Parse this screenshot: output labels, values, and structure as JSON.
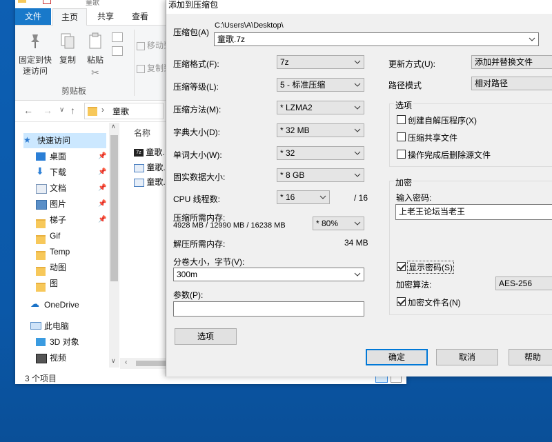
{
  "explorer": {
    "title": "童歌",
    "tabs": {
      "file": "文件",
      "home": "主页",
      "share": "共享",
      "view": "查看"
    },
    "ribbon": {
      "pin_label_1": "固定到快",
      "pin_label_2": "速访问",
      "copy_label": "复制",
      "paste_label": "粘贴",
      "move_to_label": "移动到",
      "copy_to_label": "复制到",
      "clipboard_group": "剪贴板"
    },
    "address": {
      "crumb": "童歌"
    },
    "nav": {
      "quick_access": "快速访问",
      "items": [
        "桌面",
        "下载",
        "文档",
        "图片",
        "梯子",
        "Gif",
        "Temp",
        "动图",
        "图"
      ],
      "onedrive": "OneDrive",
      "this_pc": "此电脑",
      "pc_items": [
        "3D 对象",
        "视频"
      ]
    },
    "filelist": {
      "header_name": "名称",
      "files": [
        "童歌.",
        "童歌.",
        "童歌."
      ]
    },
    "status": "3 个项目"
  },
  "dialog": {
    "title": "添加到压缩包",
    "archive_label": "压缩包(A)",
    "archive_path": "C:\\Users\\A\\Desktop\\",
    "archive_name": "童歌.7z",
    "format_label": "压缩格式(F):",
    "format_value": "7z",
    "level_label": "压缩等级(L):",
    "level_value": "5 - 标准压缩",
    "method_label": "压缩方法(M):",
    "method_value": "* LZMA2",
    "dict_label": "字典大小(D):",
    "dict_value": "* 32 MB",
    "word_label": "单词大小(W):",
    "word_value": "* 32",
    "solid_label": "固实数据大小:",
    "solid_value": "* 8 GB",
    "threads_label": "CPU 线程数:",
    "threads_value": "* 16",
    "threads_total": "/ 16",
    "mem_compress_label": "压缩所需内存:",
    "mem_compress_value": "4928 MB / 12990 MB / 16238 MB",
    "mem_percent": "* 80%",
    "mem_decompress_label": "解压所需内存:",
    "mem_decompress_value": "34 MB",
    "volume_label": "分卷大小，字节(V):",
    "volume_value": "300m",
    "params_label": "参数(P):",
    "params_value": "",
    "options_button": "选项",
    "update_label": "更新方式(U):",
    "update_value": "添加并替换文件",
    "path_label": "路径模式",
    "path_value": "相对路径",
    "options_group": "选项",
    "opt_sfx": "创建自解压程序(X)",
    "opt_shared": "压缩共享文件",
    "opt_delete": "操作完成后删除源文件",
    "encrypt_group": "加密",
    "password_label": "输入密码:",
    "password_value": "上老王论坛当老王",
    "show_password": "显示密码(S)",
    "encrypt_method_label": "加密算法:",
    "encrypt_method_value": "AES-256",
    "encrypt_names": "加密文件名(N)",
    "ok": "确定",
    "cancel": "取消",
    "help": "帮助"
  }
}
